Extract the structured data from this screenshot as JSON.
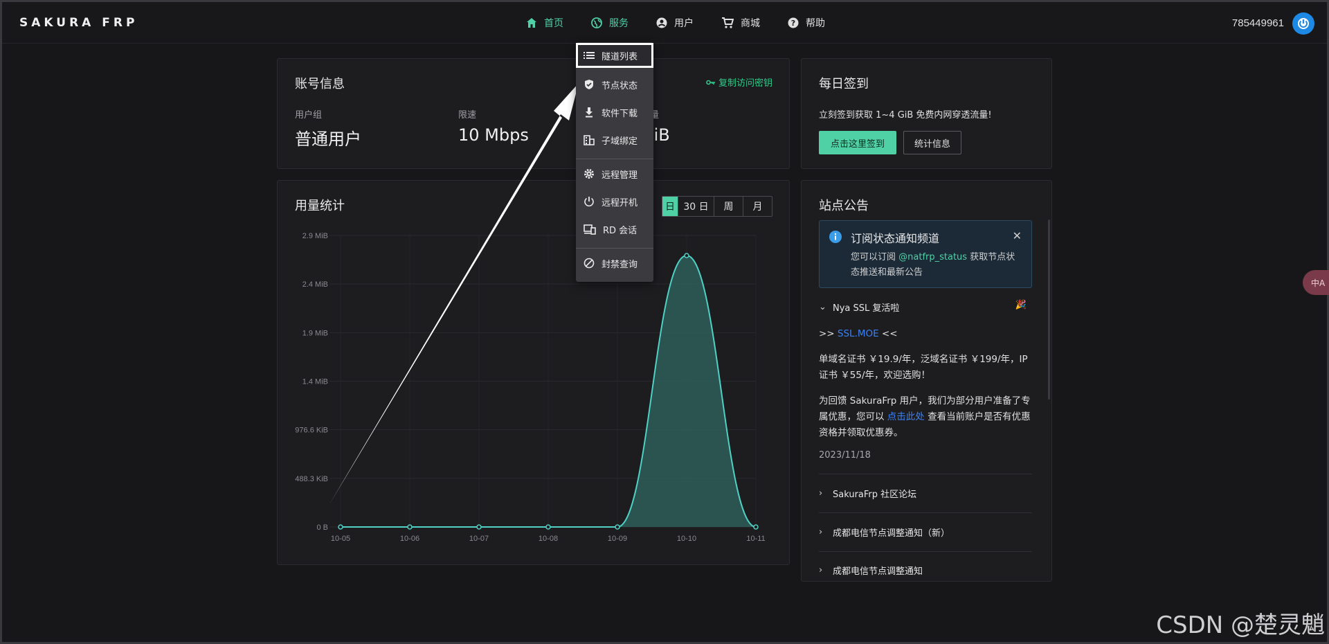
{
  "header": {
    "logo": "SAKURA FRP",
    "nav": [
      {
        "label": "首页",
        "icon": "home-icon"
      },
      {
        "label": "服务",
        "icon": "globe-icon"
      },
      {
        "label": "用户",
        "icon": "user-icon"
      },
      {
        "label": "商城",
        "icon": "cart-icon"
      },
      {
        "label": "帮助",
        "icon": "help-icon"
      }
    ],
    "user_id": "785449961"
  },
  "account": {
    "title": "账号信息",
    "copy_key": "复制访问密钥",
    "group_label": "用户组",
    "group_value": "普通用户",
    "speed_label": "限速",
    "speed_value": "10 Mbps",
    "traffic_label_partial": "量",
    "traffic_value_partial": "GiB"
  },
  "checkin": {
    "title": "每日签到",
    "text": "立刻签到获取 1~4 GiB 免费内网穿透流量!",
    "checkin_button": "点击这里签到",
    "stats_button": "统计信息"
  },
  "usage": {
    "title": "用量统计",
    "ranges": [
      {
        "label": "日",
        "active": true
      },
      {
        "label": "30 日",
        "active": false
      },
      {
        "label": "周",
        "active": false
      },
      {
        "label": "月",
        "active": false
      }
    ]
  },
  "chart_data": {
    "type": "area",
    "title": "",
    "xlabel": "",
    "ylabel": "",
    "x": [
      "10-05",
      "10-06",
      "10-07",
      "10-08",
      "10-09",
      "10-10",
      "10-11"
    ],
    "series": [
      {
        "values_mib": [
          0,
          0,
          0,
          0,
          0,
          2.7,
          0
        ]
      }
    ],
    "y_ticks": [
      "0 B",
      "488.3 KiB",
      "976.6 KiB",
      "1.4 MiB",
      "1.9 MiB",
      "2.4 MiB",
      "2.9 MiB"
    ],
    "ylim_mib": [
      0,
      2.9
    ],
    "grid": true,
    "colors": {
      "line": "#4fd1c5",
      "fill": "#2e5e5a"
    }
  },
  "dropdown": {
    "items": [
      {
        "label": "隧道列表",
        "icon": "list-icon",
        "selected": true
      },
      {
        "label": "节点状态",
        "icon": "shield-check-icon"
      },
      {
        "label": "软件下载",
        "icon": "download-icon"
      },
      {
        "label": "子域绑定",
        "icon": "building-icon"
      },
      {
        "label": "远程管理",
        "icon": "gear-icon"
      },
      {
        "label": "远程开机",
        "icon": "power-icon"
      },
      {
        "label": "RD 会话",
        "icon": "remote-desktop-icon"
      },
      {
        "label": "封禁查询",
        "icon": "ban-icon"
      }
    ]
  },
  "announcements": {
    "title": "站点公告",
    "notice": {
      "title": "订阅状态通知频道",
      "body_prefix": "您可以订阅 ",
      "body_handle": "@natfrp_status",
      "body_suffix": " 获取节点状态推送和最新公告"
    },
    "expanded": {
      "title": "Nya SSL 复活啦",
      "line1_prefix": ">> ",
      "line1_link": "SSL.MOE",
      "line1_suffix": " <<",
      "para1": "单域名证书 ￥19.9/年，泛域名证书 ￥199/年，IP 证书 ￥55/年，欢迎选购！",
      "para2_prefix": "为回馈 SakuraFrp 用户，我们为部分用户准备了专属优惠，您可以 ",
      "para2_link": "点击此处",
      "para2_suffix": " 查看当前账户是否有优惠资格并领取优惠券。",
      "date": "2023/11/18"
    },
    "collapsed": [
      "SakuraFrp 社区论坛",
      "成都电信节点调整通知（新）",
      "成都电信节点调整通知"
    ]
  },
  "translate_label": "中A",
  "watermark": "CSDN @楚灵魈",
  "colors": {
    "accent": "#4fd1a5",
    "link": "#3b82f6",
    "background": "#17171a",
    "card": "#1d1d20"
  }
}
